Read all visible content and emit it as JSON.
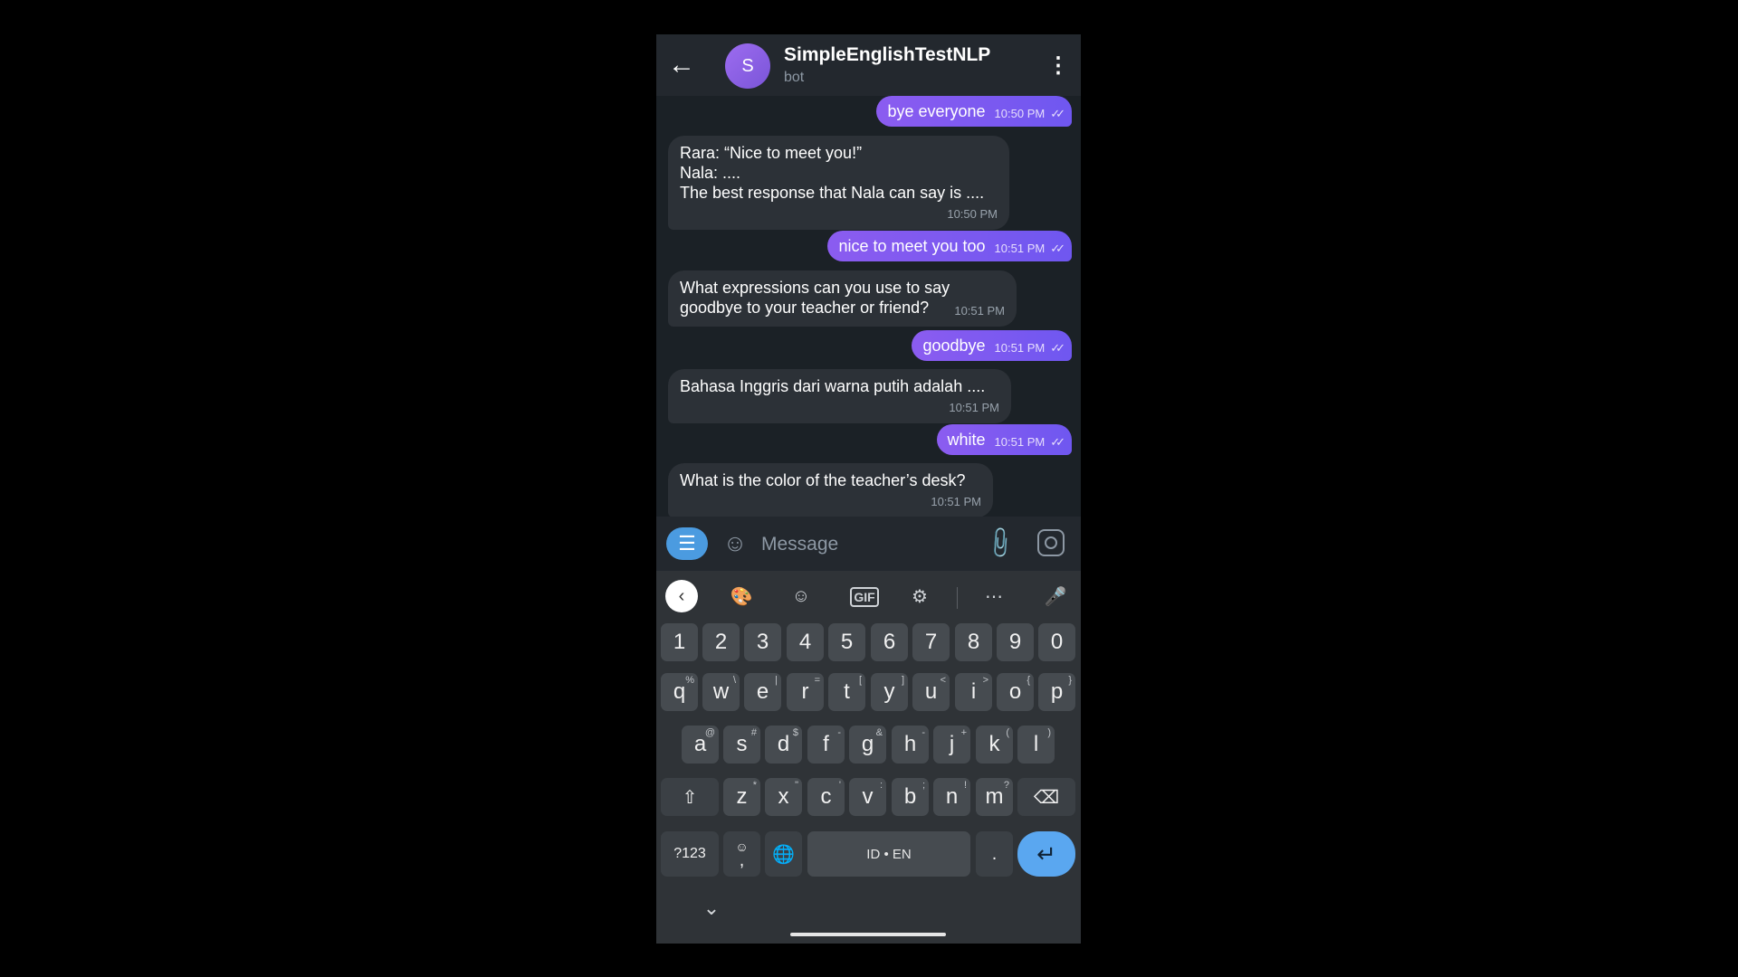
{
  "header": {
    "back_icon": "arrow-left-icon",
    "avatar_letter": "S",
    "title": "SimpleEnglishTestNLP",
    "subtitle": "bot",
    "menu_icon": "more-vertical-icon"
  },
  "messages": [
    {
      "dir": "out",
      "text": "bye everyone",
      "time": "10:50 PM",
      "status": "read"
    },
    {
      "dir": "in",
      "lines": [
        "Rara: “Nice to meet you!”",
        "Nala: ....",
        "The best response that Nala can say is ...."
      ],
      "time": "10:50 PM"
    },
    {
      "dir": "out",
      "text": "nice to meet you too",
      "time": "10:51 PM",
      "status": "read"
    },
    {
      "dir": "in",
      "lines": [
        "What expressions can you use to say",
        "goodbye to your teacher or friend?"
      ],
      "time": "10:51 PM"
    },
    {
      "dir": "out",
      "text": "goodbye",
      "time": "10:51 PM",
      "status": "read"
    },
    {
      "dir": "in",
      "lines": [
        "Bahasa Inggris dari warna putih adalah ...."
      ],
      "time": "10:51 PM"
    },
    {
      "dir": "out",
      "text": "white",
      "time": "10:51 PM",
      "status": "read"
    },
    {
      "dir": "in",
      "lines": [
        "What is the color of the teacher’s desk?"
      ],
      "time": "10:51 PM"
    }
  ],
  "composer": {
    "placeholder": "Message",
    "bot_menu_icon": "hamburger-menu-icon",
    "emoji_icon": "smiley-icon",
    "attach_icon": "paperclip-icon",
    "camera_icon": "instagram-camera-icon"
  },
  "keyboard": {
    "toolbar": {
      "gif_label": "GIF"
    },
    "rows": {
      "numbers": [
        "1",
        "2",
        "3",
        "4",
        "5",
        "6",
        "7",
        "8",
        "9",
        "0"
      ],
      "row1": [
        [
          "q",
          "%"
        ],
        [
          "w",
          "\\"
        ],
        [
          "e",
          "|"
        ],
        [
          "r",
          "="
        ],
        [
          "t",
          "["
        ],
        [
          "y",
          "]"
        ],
        [
          "u",
          "<"
        ],
        [
          "i",
          ">"
        ],
        [
          "o",
          "{"
        ],
        [
          "p",
          "}"
        ]
      ],
      "row2": [
        [
          "a",
          "@"
        ],
        [
          "s",
          "#"
        ],
        [
          "d",
          "$"
        ],
        [
          "f",
          "-"
        ],
        [
          "g",
          "&"
        ],
        [
          "h",
          "-"
        ],
        [
          "j",
          "+"
        ],
        [
          "k",
          "("
        ],
        [
          "l",
          ")"
        ]
      ],
      "row3": [
        [
          "z",
          "*"
        ],
        [
          "x",
          "\""
        ],
        [
          "c",
          "'"
        ],
        [
          "v",
          ":"
        ],
        [
          "b",
          ";"
        ],
        [
          "n",
          "!"
        ],
        [
          "m",
          "?"
        ]
      ]
    },
    "symbols_label": "?123",
    "comma_label": ",",
    "comma_alt": "☺",
    "space_label": "ID • EN",
    "period_label": "."
  }
}
